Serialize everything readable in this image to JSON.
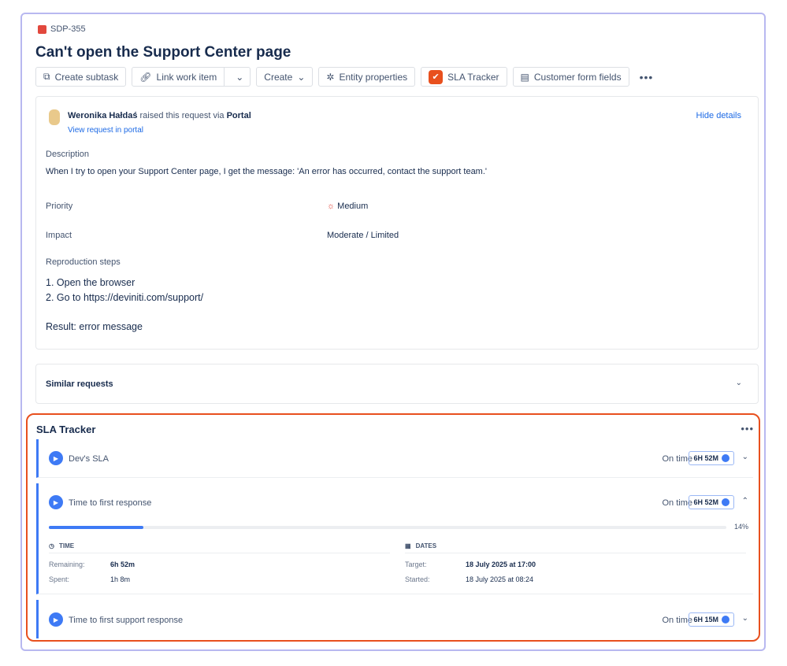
{
  "issue": {
    "key": "SDP-355",
    "title": "Can't open the Support Center page"
  },
  "toolbar": {
    "create_subtask": "Create subtask",
    "link_work_item": "Link work item",
    "create": "Create",
    "entity_properties": "Entity properties",
    "sla_tracker": "SLA Tracker",
    "customer_form_fields": "Customer form fields"
  },
  "request": {
    "reporter": "Weronika Hałdaś",
    "raised_text": "raised this request via",
    "channel": "Portal",
    "view_link": "View request in portal",
    "hide_details": "Hide details"
  },
  "fields": {
    "description_label": "Description",
    "description": "When I try to open your Support Center page, I get the message: 'An error has occurred, contact the support team.'",
    "priority_label": "Priority",
    "priority": "Medium",
    "impact_label": "Impact",
    "impact": "Moderate / Limited",
    "repro_label": "Reproduction steps",
    "repro_1": "1. Open the browser",
    "repro_2": "2. Go to https://deviniti.com/support/",
    "repro_result": "Result: error message"
  },
  "similar": {
    "title": "Similar requests"
  },
  "sla": {
    "title": "SLA Tracker",
    "items": [
      {
        "name": "Dev's SLA",
        "status": "On time",
        "badge": "6H 52M"
      },
      {
        "name": "Time to first response",
        "status": "On time",
        "badge": "6H 52M",
        "progress_pct": 14,
        "progress_label": "14%",
        "time_label": "TIME",
        "dates_label": "DATES",
        "remaining_label": "Remaining:",
        "remaining": "6h 52m",
        "spent_label": "Spent:",
        "spent": "1h 8m",
        "target_label": "Target:",
        "target": "18 July 2025 at 17:00",
        "started_label": "Started:",
        "started": "18 July 2025 at 08:24"
      },
      {
        "name": "Time to first support response",
        "status": "On time",
        "badge": "6H 15M"
      }
    ]
  }
}
